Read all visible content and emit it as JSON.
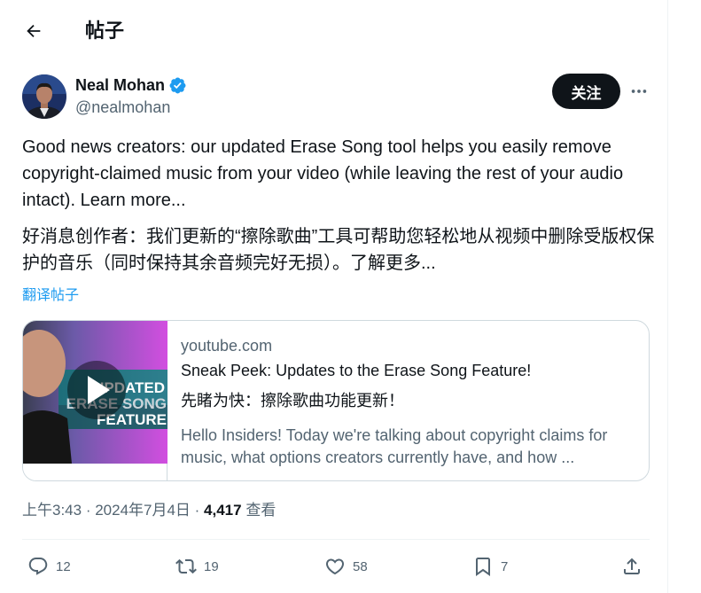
{
  "header": {
    "title": "帖子",
    "back_icon": "arrow-left-icon"
  },
  "author": {
    "name": "Neal Mohan",
    "handle": "@nealmohan",
    "verified_icon": "verified-badge-icon",
    "verified_color": "#1d9bf0"
  },
  "follow_label": "关注",
  "more_icon": "more-horizontal-icon",
  "tweet": {
    "text_en": "Good news creators: our updated Erase Song tool helps you easily remove copyright-claimed music from your video (while leaving the rest of your audio intact). Learn more...",
    "text_cn": "好消息创作者：我们更新的“擦除歌曲”工具可帮助您轻松地从视频中删除受版权保护的音乐（同时保持其余音频完好无损）。了解更多...",
    "translate_label": "翻译帖子"
  },
  "card": {
    "thumbnail_text": "UPDATED ERASE SONG FEATURE",
    "domain": "youtube.com",
    "title": "Sneak Peek: Updates to the Erase Song Feature!",
    "title_cn": "先睹为快：擦除歌曲功能更新！",
    "description": "Hello Insiders! Today we're talking about copyright claims for music, what options creators currently have, and how ..."
  },
  "meta": {
    "time": "上午3:43",
    "separator": " · ",
    "date": "2024年7月4日",
    "views_count": "4,417",
    "views_label": "查看"
  },
  "actions": {
    "reply": {
      "icon": "reply-icon",
      "count": "12"
    },
    "retweet": {
      "icon": "retweet-icon",
      "count": "19"
    },
    "like": {
      "icon": "heart-icon",
      "count": "58"
    },
    "bookmark": {
      "icon": "bookmark-icon",
      "count": "7"
    },
    "share": {
      "icon": "share-icon"
    }
  },
  "colors": {
    "accent": "#1d9bf0",
    "text": "#0f1419",
    "secondary": "#536471",
    "border": "#cfd9de"
  }
}
